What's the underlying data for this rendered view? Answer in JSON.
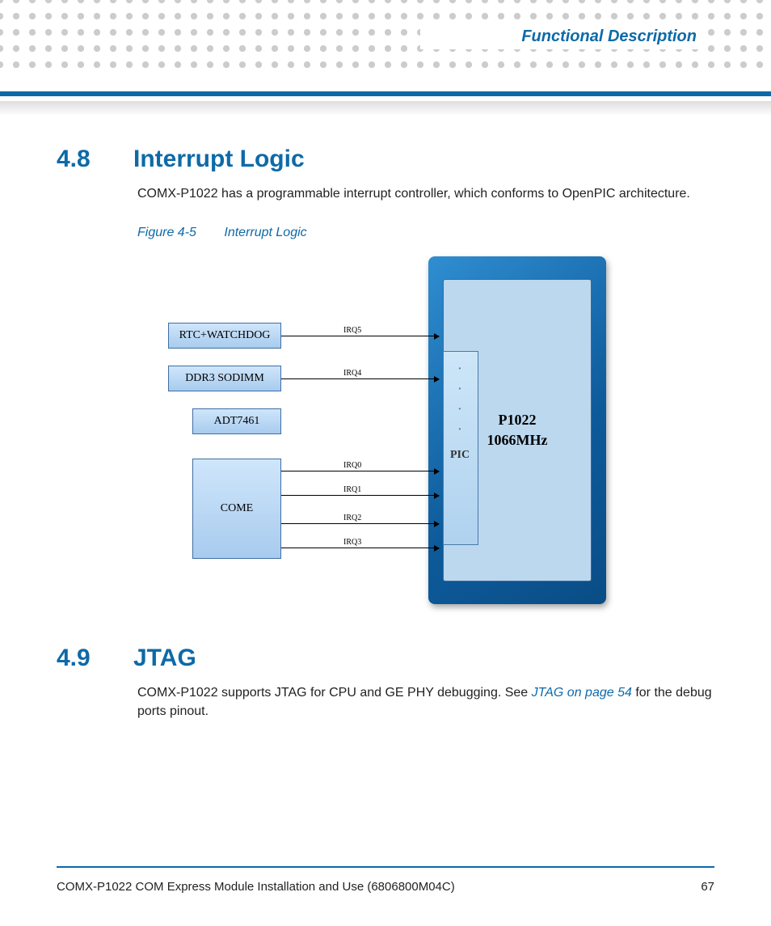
{
  "chapter_title": "Functional Description",
  "sections": {
    "s48": {
      "num": "4.8",
      "title": "Interrupt Logic",
      "body": "COMX-P1022 has a programmable interrupt controller, which conforms to OpenPIC architecture."
    },
    "s49": {
      "num": "4.9",
      "title": "JTAG",
      "body_pre": "COMX-P1022 supports JTAG for CPU and GE PHY debugging. See ",
      "link_text": "JTAG",
      "link_suffix": " on page 54",
      "body_post": " for the debug ports pinout."
    }
  },
  "figure": {
    "label": "Figure 4-5",
    "caption": "Interrupt Logic"
  },
  "diagram": {
    "sources": {
      "rtc": "RTC+WATCHDOG",
      "ddr": "DDR3 SODIMM",
      "adt": "ADT7461",
      "come": "COME"
    },
    "pic": "PIC",
    "cpu_line1": "P1022",
    "cpu_line2": "1066MHz",
    "irqs": {
      "irq5": "IRQ5",
      "irq4": "IRQ4",
      "irq0": "IRQ0",
      "irq1": "IRQ1",
      "irq2": "IRQ2",
      "irq3": "IRQ3"
    }
  },
  "footer": {
    "doc": "COMX-P1022 COM Express Module Installation and Use (6806800M04C)",
    "page": "67"
  }
}
